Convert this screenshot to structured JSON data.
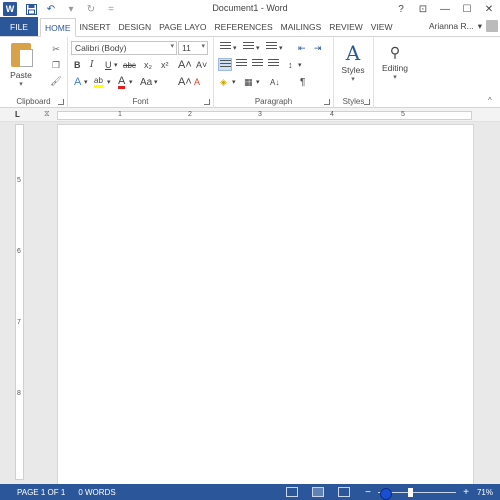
{
  "app": {
    "title": "Document1 - Word"
  },
  "qat": {
    "undo_dropdown": "▾",
    "customize": "="
  },
  "window_controls": {
    "help": "?",
    "restore_ribbon": "⊡",
    "minimize": "—",
    "maximize": "☐",
    "close": "✕"
  },
  "tabs": [
    {
      "label": "FILE"
    },
    {
      "label": "HOME"
    },
    {
      "label": "INSERT"
    },
    {
      "label": "DESIGN"
    },
    {
      "label": "PAGE LAYO"
    },
    {
      "label": "REFERENCES"
    },
    {
      "label": "MAILINGS"
    },
    {
      "label": "REVIEW"
    },
    {
      "label": "VIEW"
    }
  ],
  "user": {
    "name": "Arianna R...",
    "dropdown": "▾"
  },
  "ribbon": {
    "clipboard": {
      "label": "Clipboard",
      "paste_label": "Paste",
      "paste_dd": "▾"
    },
    "font": {
      "label": "Font",
      "font_name": "Calibri (Body)",
      "font_size": "11",
      "grow": "A˄",
      "shrink": "A˅",
      "change_case": "Aa",
      "clear": "A",
      "bold": "B",
      "italic": "I",
      "underline": "U",
      "strike": "abc",
      "subscript": "x₂",
      "superscript": "x²",
      "text_effects": "A",
      "highlight": "ab",
      "font_color": "A",
      "case": "Aa",
      "grow2": "A˄",
      "shrink2": "A˅"
    },
    "paragraph": {
      "label": "Paragraph",
      "pilcrow": "¶",
      "sort": "A↓"
    },
    "styles": {
      "label": "Styles",
      "button_label": "Styles"
    },
    "editing": {
      "button_label": "Editing"
    }
  },
  "ruler": {
    "corner": "L",
    "h_ticks": [
      "1",
      "2",
      "3",
      "4",
      "5"
    ],
    "v_ticks": [
      "5",
      "6",
      "7",
      "8"
    ]
  },
  "status": {
    "page": "PAGE 1 OF 1",
    "words": "0 WORDS",
    "zoom_minus": "−",
    "zoom_plus": "+",
    "zoom": "71%",
    "zoom_level_fraction": 0.42
  },
  "colors": {
    "accent": "#2b579a",
    "highlight": "#ffff00",
    "font_color": "#e02020"
  }
}
